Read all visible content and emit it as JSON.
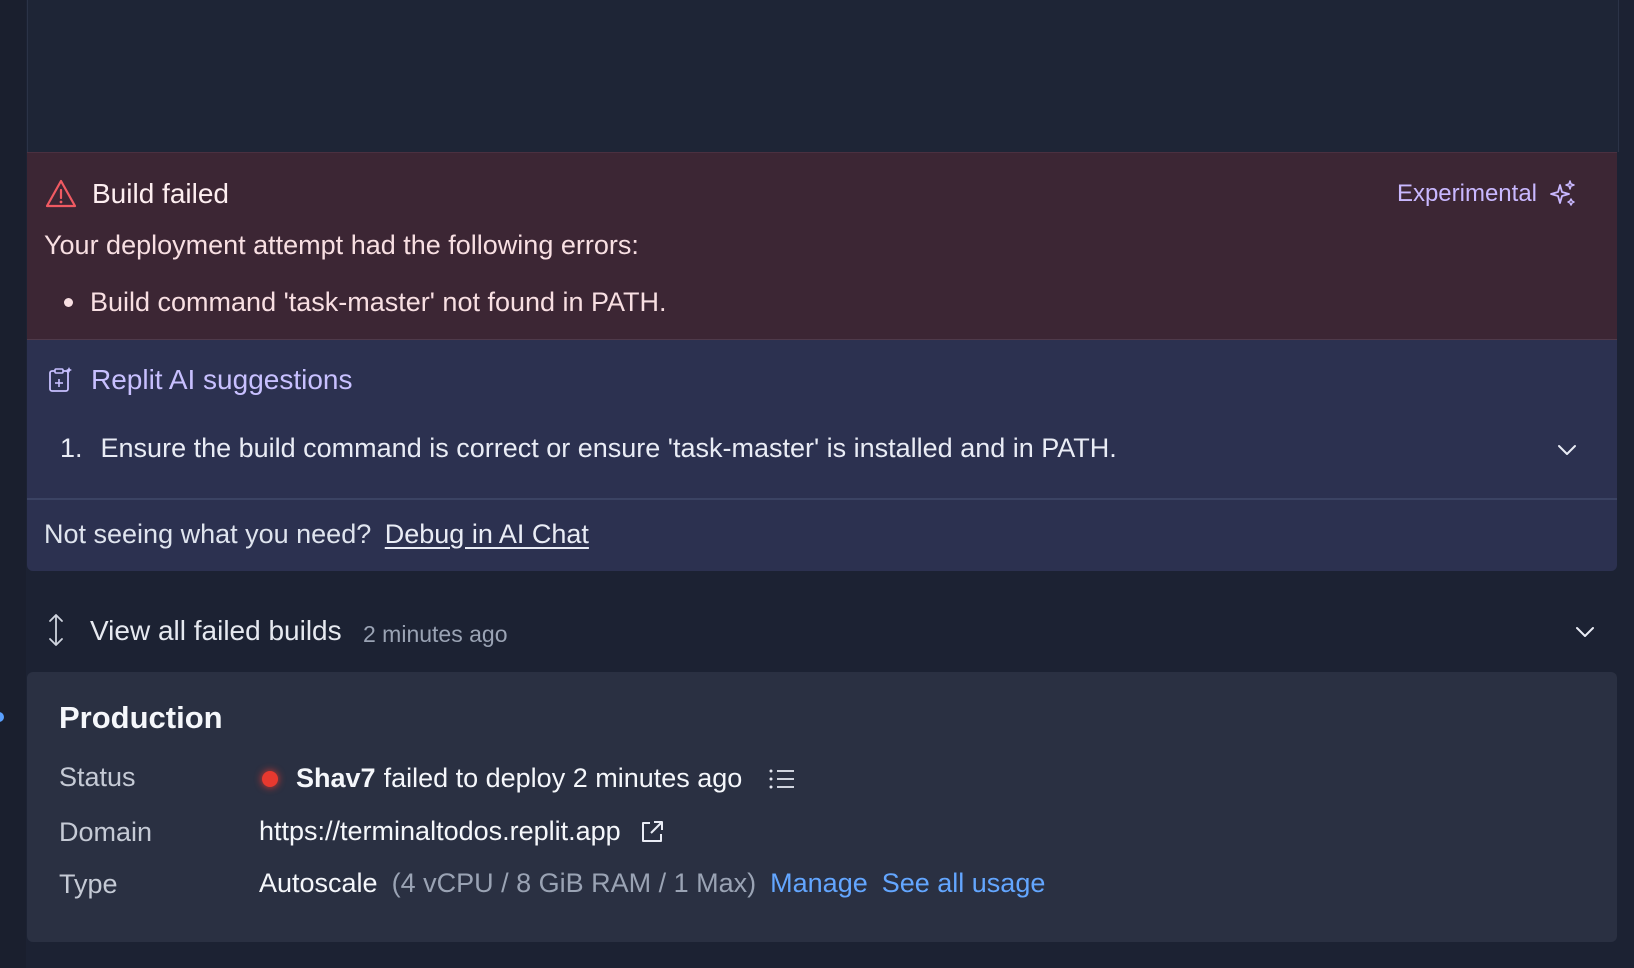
{
  "error": {
    "title": "Build failed",
    "experimental_label": "Experimental",
    "subtitle": "Your deployment attempt had the following errors:",
    "errors": [
      "Build command 'task-master' not found in PATH."
    ]
  },
  "ai": {
    "title": "Replit AI suggestions",
    "suggestions": [
      {
        "number": "1.",
        "text": "Ensure the build command is correct or ensure 'task-master' is installed and in PATH."
      }
    ]
  },
  "debug": {
    "prompt": "Not seeing what you need?",
    "link": "Debug in AI Chat"
  },
  "failed_builds": {
    "label": "View all failed builds",
    "time": "2 minutes ago"
  },
  "production": {
    "title": "Production",
    "status_label": "Status",
    "status_user": "Shav7",
    "status_text": "failed to deploy 2 minutes ago",
    "domain_label": "Domain",
    "domain_value": "https://terminaltodos.replit.app",
    "type_label": "Type",
    "type_value": "Autoscale",
    "type_detail": "(4 vCPU / 8 GiB RAM / 1 Max)",
    "manage_link": "Manage",
    "usage_link": "See all usage"
  },
  "colors": {
    "status_failed": "#e8392f",
    "link": "#63a6ff",
    "ai_accent": "#c8c0ff",
    "error_bg": "#3c2634"
  }
}
